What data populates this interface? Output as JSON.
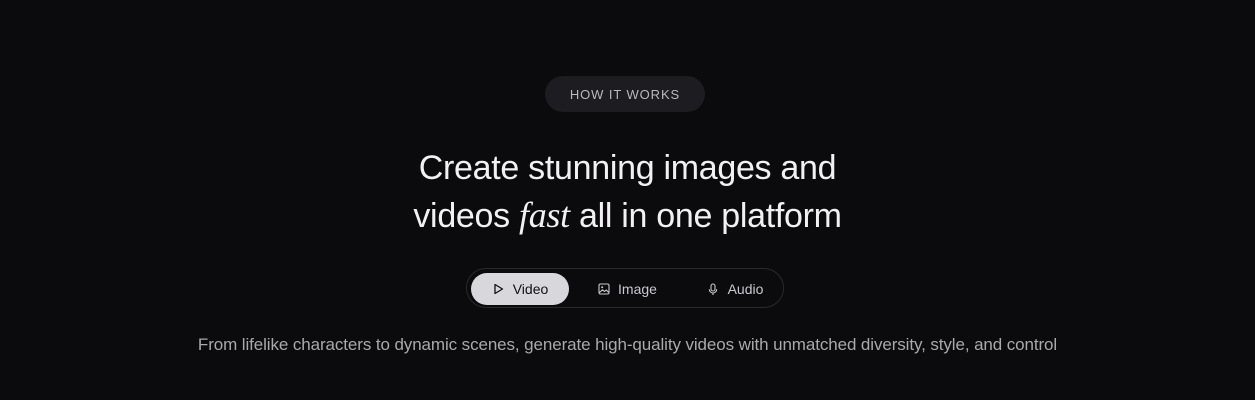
{
  "badge": {
    "label": "HOW IT WORKS"
  },
  "heading": {
    "line1": "Create stunning images and",
    "line2_before": "videos ",
    "line2_accent": "fast",
    "line2_after": " all in one platform"
  },
  "tabs": [
    {
      "label": "Video",
      "icon": "play-icon",
      "active": true
    },
    {
      "label": "Image",
      "icon": "image-icon",
      "active": false
    },
    {
      "label": "Audio",
      "icon": "microphone-icon",
      "active": false
    }
  ],
  "subtitle": "From lifelike characters to dynamic scenes, generate high-quality videos with unmatched diversity, style, and control",
  "colors": {
    "background": "#0b0a0d",
    "badge_bg": "#1d1c20",
    "active_tab_bg": "#d8d7dc",
    "heading_text": "#f1f0f3",
    "subtitle_text": "#a9a8ad"
  }
}
